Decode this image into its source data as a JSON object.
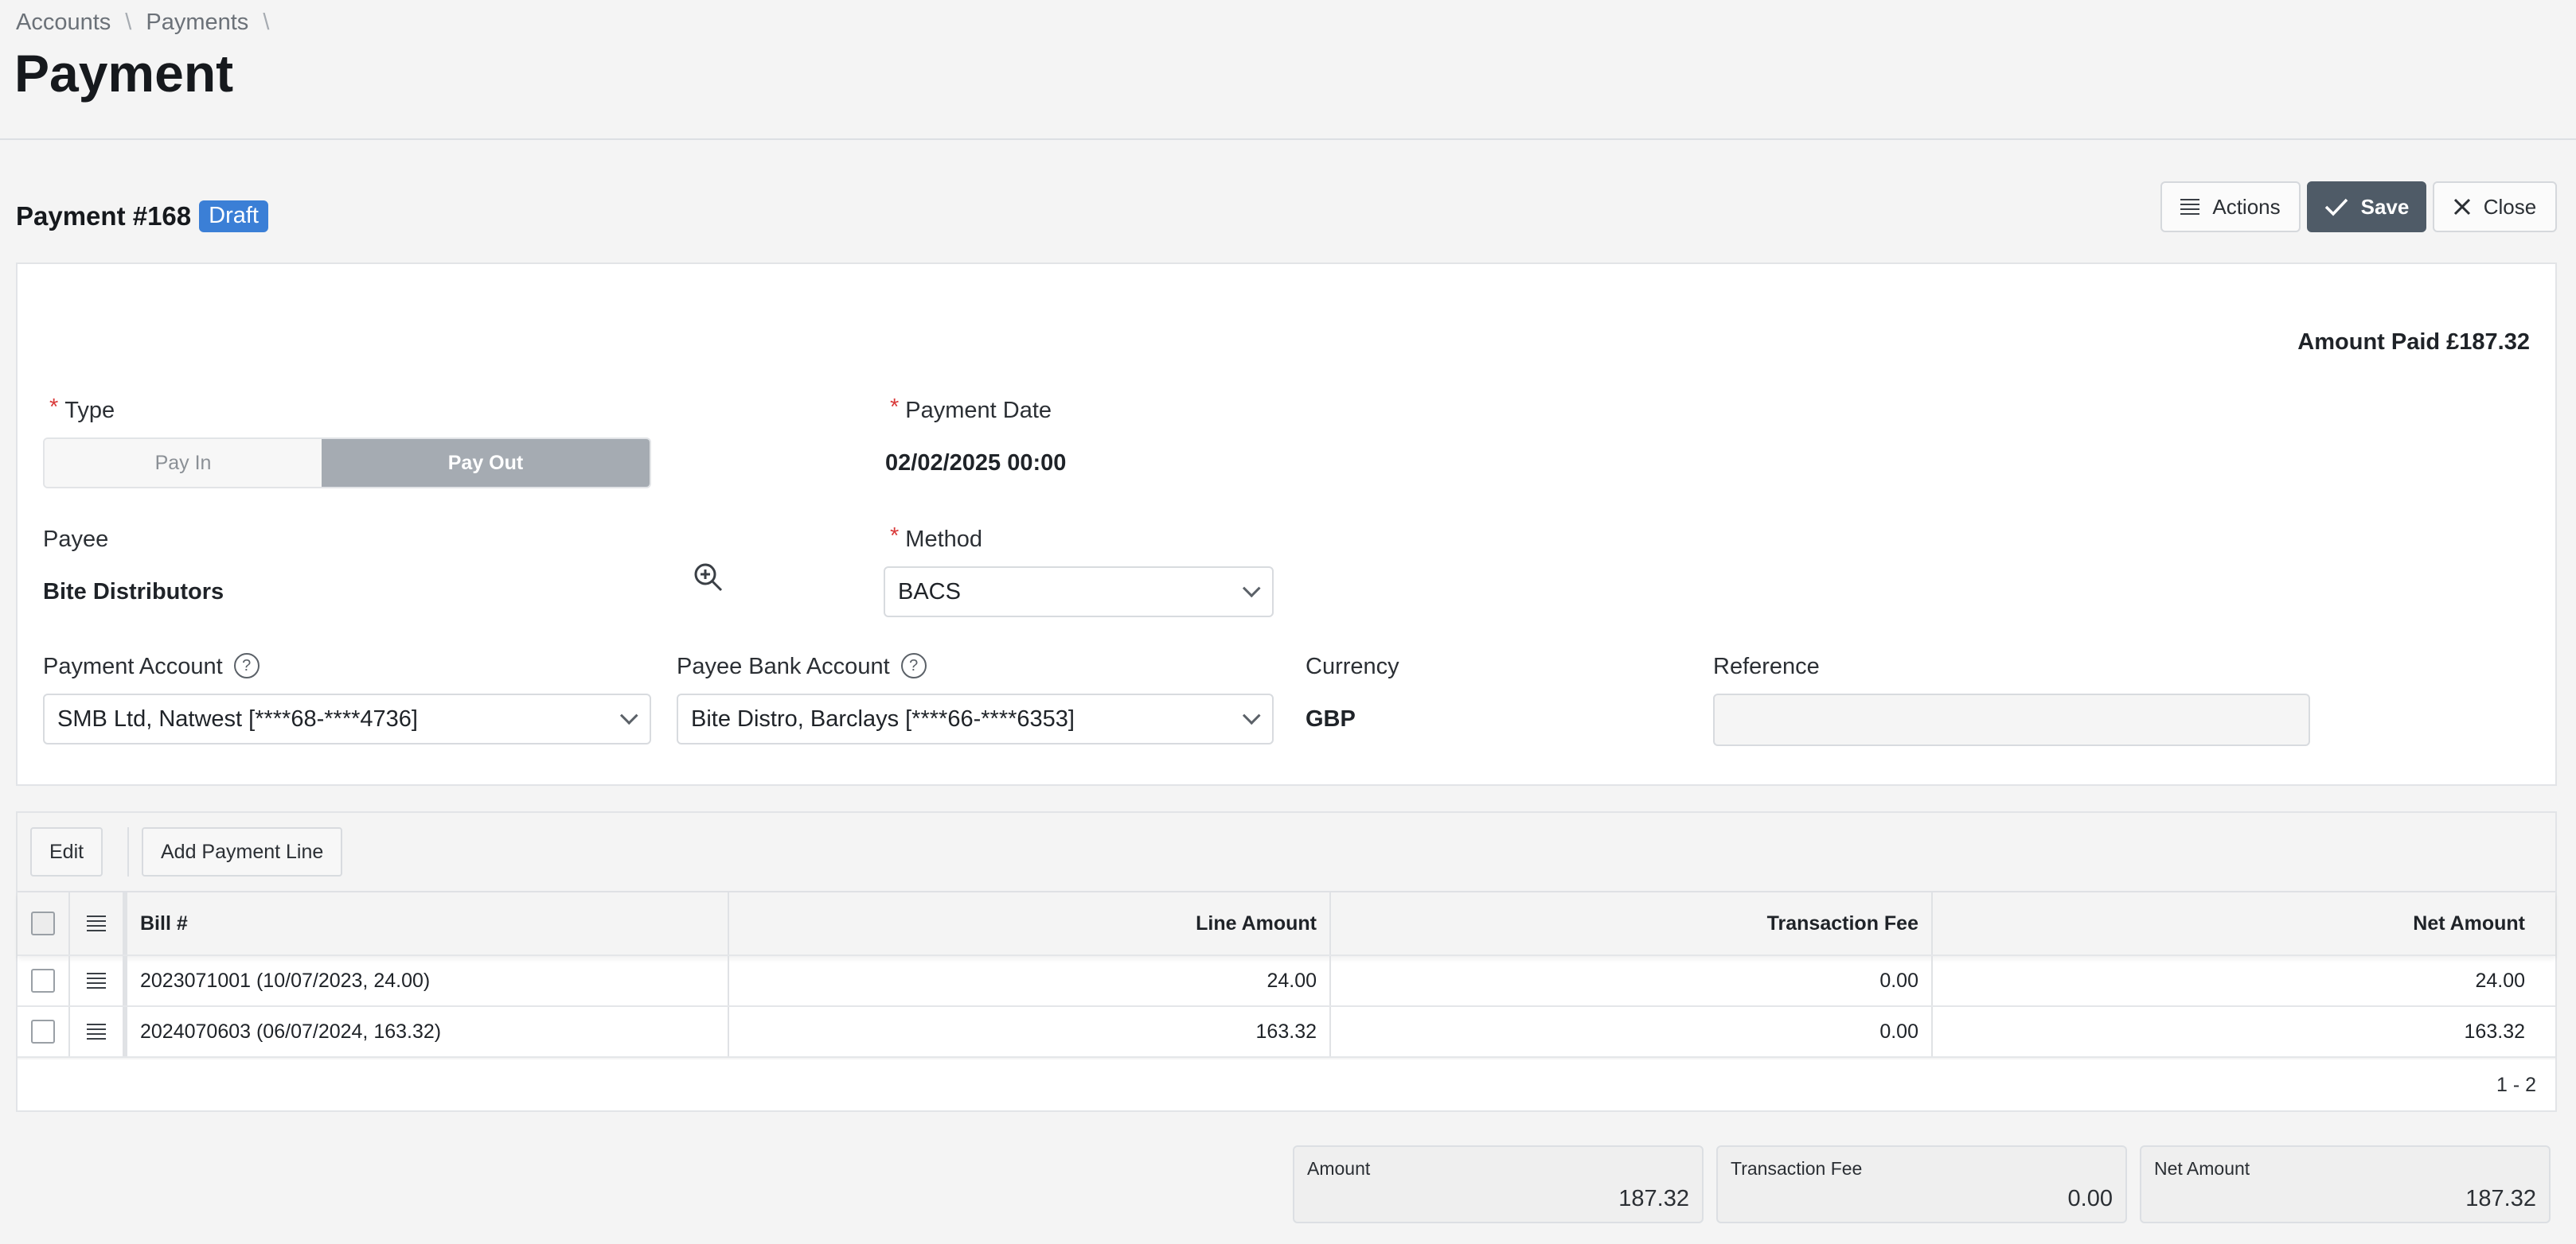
{
  "breadcrumb": {
    "items": [
      "Accounts",
      "Payments"
    ],
    "separator": "\\"
  },
  "page_title": "Payment",
  "document": {
    "title": "Payment #168",
    "status": "Draft"
  },
  "toolbar": {
    "actions_label": "Actions",
    "save_label": "Save",
    "close_label": "Close"
  },
  "amount_paid": "Amount Paid £187.32",
  "form": {
    "type": {
      "label": "Type",
      "options": [
        "Pay In",
        "Pay Out"
      ],
      "selected": "Pay Out"
    },
    "payment_date": {
      "label": "Payment Date",
      "value": "02/02/2025 00:00"
    },
    "payee": {
      "label": "Payee",
      "value": "Bite Distributors"
    },
    "method": {
      "label": "Method",
      "value": "BACS"
    },
    "payment_account": {
      "label": "Payment Account",
      "value": "SMB Ltd, Natwest [****68-****4736]"
    },
    "payee_bank_account": {
      "label": "Payee Bank Account",
      "value": "Bite Distro, Barclays [****66-****6353]"
    },
    "currency": {
      "label": "Currency",
      "value": "GBP"
    },
    "reference": {
      "label": "Reference",
      "value": ""
    }
  },
  "grid": {
    "toolbar": {
      "edit_label": "Edit",
      "add_label": "Add Payment Line"
    },
    "columns": [
      "Bill #",
      "Line Amount",
      "Transaction Fee",
      "Net Amount"
    ],
    "rows": [
      {
        "bill": "2023071001 (10/07/2023, 24.00)",
        "line_amount": "24.00",
        "fee": "0.00",
        "net": "24.00"
      },
      {
        "bill": "2024070603 (06/07/2024, 163.32)",
        "line_amount": "163.32",
        "fee": "0.00",
        "net": "163.32"
      }
    ],
    "pager": "1 - 2"
  },
  "totals": {
    "amount": {
      "label": "Amount",
      "value": "187.32"
    },
    "fee": {
      "label": "Transaction Fee",
      "value": "0.00"
    },
    "net": {
      "label": "Net Amount",
      "value": "187.32"
    }
  },
  "colors": {
    "accent": "#3b7fd6",
    "save_bg": "#4f5b67",
    "required": "#d93a3a",
    "toggle_selected": "#a5abb2"
  }
}
